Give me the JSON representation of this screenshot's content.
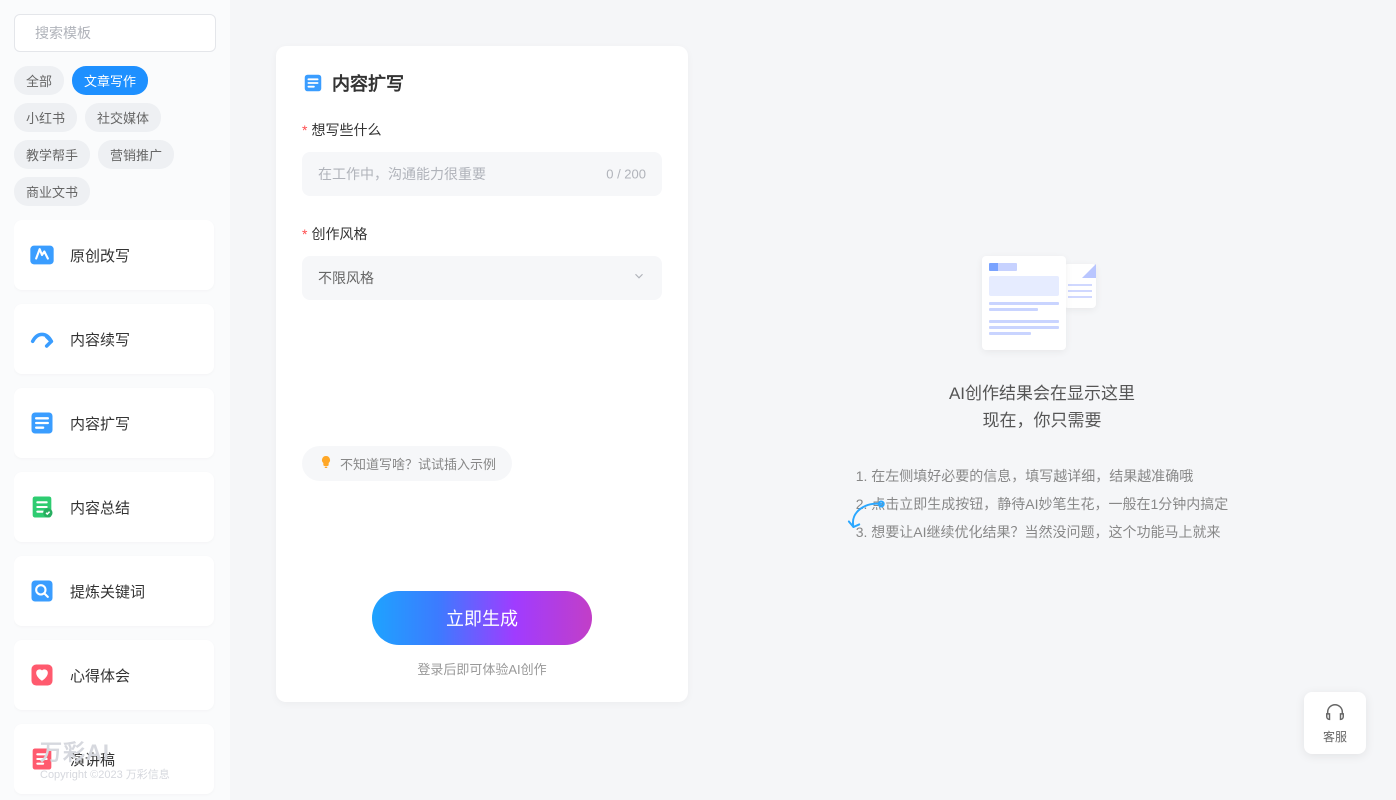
{
  "sidebar": {
    "search_placeholder": "搜索模板",
    "tags": [
      "全部",
      "文章写作",
      "小红书",
      "社交媒体",
      "教学帮手",
      "营销推广",
      "商业文书"
    ],
    "active_tag_index": 1,
    "templates": [
      {
        "label": "原创改写",
        "icon": "pencil",
        "color": "#3a9dff"
      },
      {
        "label": "内容续写",
        "icon": "continue",
        "color": "#3a9dff"
      },
      {
        "label": "内容扩写",
        "icon": "expand",
        "color": "#3a9dff"
      },
      {
        "label": "内容总结",
        "icon": "summary",
        "color": "#2ecc71"
      },
      {
        "label": "提炼关键词",
        "icon": "keywords",
        "color": "#3a9dff"
      },
      {
        "label": "心得体会",
        "icon": "heart",
        "color": "#ff5a6e"
      },
      {
        "label": "演讲稿",
        "icon": "speech",
        "color": "#ff5a6e"
      }
    ],
    "active_template_index": 2
  },
  "form": {
    "title": "内容扩写",
    "q1_label": "想写些什么",
    "q1_placeholder": "在工作中，沟通能力很重要",
    "q1_count": "0 / 200",
    "q2_label": "创作风格",
    "style_value": "不限风格",
    "hint": "不知道写啥？试试插入示例",
    "generate": "立即生成",
    "login_hint": "登录后即可体验AI创作"
  },
  "result": {
    "title_line1": "AI创作结果会在显示这里",
    "title_line2": "现在，你只需要",
    "steps": [
      "1. 在左侧填好必要的信息，填写越详细，结果越准确哦",
      "2. 点击立即生成按钮，静待AI妙笔生花，一般在1分钟内搞定",
      "3. 想要让AI继续优化结果？当然没问题，这个功能马上就来"
    ]
  },
  "footer": {
    "brand": "万彩AI",
    "copyright": "Copyright ©2023 万彩信息"
  },
  "cs_label": "客服"
}
